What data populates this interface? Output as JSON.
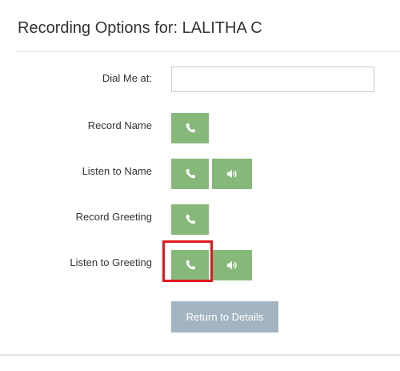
{
  "header": {
    "title": "Recording Options for: LALITHA C"
  },
  "form": {
    "dial_label": "Dial Me at:",
    "dial_value": "",
    "dial_placeholder": "",
    "record_name_label": "Record Name",
    "listen_name_label": "Listen to Name",
    "record_greeting_label": "Record Greeting",
    "listen_greeting_label": "Listen to Greeting"
  },
  "buttons": {
    "return_label": "Return to Details",
    "phone_icon": "phone-icon",
    "speaker_icon": "speaker-icon"
  },
  "colors": {
    "green_button": "#86b87a",
    "return_button": "#a3b5c2",
    "highlight": "#e0191f"
  }
}
